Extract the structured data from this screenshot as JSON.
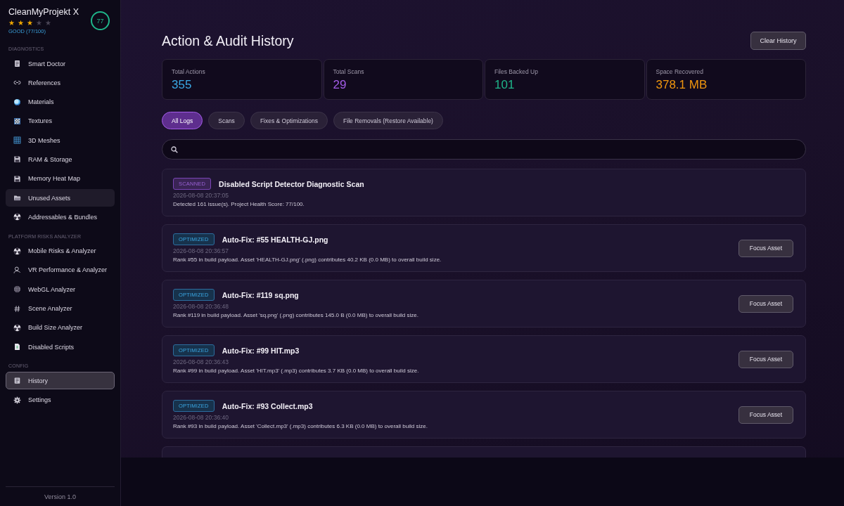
{
  "app": {
    "name": "CleanMyProjekt X",
    "stars": 3,
    "rating": "GOOD (77/100)",
    "score": "77"
  },
  "sidebar": {
    "sections": [
      {
        "label": "DIAGNOSTICS",
        "items": [
          {
            "label": "Smart Doctor",
            "selected": false,
            "hovered": false
          },
          {
            "label": "References",
            "selected": false,
            "hovered": false
          },
          {
            "label": "Materials",
            "selected": false,
            "hovered": false
          },
          {
            "label": "Textures",
            "selected": false,
            "hovered": false
          },
          {
            "label": "3D Meshes",
            "selected": false,
            "hovered": false
          },
          {
            "label": "RAM & Storage",
            "selected": false,
            "hovered": false
          },
          {
            "label": "Memory Heat Map",
            "selected": false,
            "hovered": false
          },
          {
            "label": "Unused Assets",
            "selected": false,
            "hovered": true
          },
          {
            "label": "Addressables & Bundles",
            "selected": false,
            "hovered": false
          }
        ]
      },
      {
        "label": "PLATFORM RISKS ANALYZER",
        "items": [
          {
            "label": "Mobile Risks & Analyzer",
            "selected": false,
            "hovered": false
          },
          {
            "label": "VR Performance & Analyzer",
            "selected": false,
            "hovered": false
          },
          {
            "label": "WebGL Analyzer",
            "selected": false,
            "hovered": false
          },
          {
            "label": "Scene Analyzer",
            "selected": false,
            "hovered": false
          },
          {
            "label": "Build Size Analyzer",
            "selected": false,
            "hovered": false
          },
          {
            "label": "Disabled Scripts",
            "selected": false,
            "hovered": false
          }
        ]
      },
      {
        "label": "CONFIG",
        "items": [
          {
            "label": "History",
            "selected": true,
            "hovered": false
          },
          {
            "label": "Settings",
            "selected": false,
            "hovered": false
          }
        ]
      }
    ],
    "version": "Version 1.0"
  },
  "page": {
    "title": "Action & Audit History",
    "clear_button": "Clear History"
  },
  "stats": [
    {
      "label": "Total Actions",
      "value": "355",
      "color": "#3aa9e6"
    },
    {
      "label": "Total Scans",
      "value": "29",
      "color": "#a35ce8"
    },
    {
      "label": "Files Backed Up",
      "value": "101",
      "color": "#1fb58a"
    },
    {
      "label": "Space Recovered",
      "value": "378.1 MB",
      "color": "#f0960e"
    }
  ],
  "filters": [
    {
      "label": "All Logs",
      "selected": true
    },
    {
      "label": "Scans",
      "selected": false
    },
    {
      "label": "Fixes & Optimizations",
      "selected": false
    },
    {
      "label": "File Removals (Restore Available)",
      "selected": false
    }
  ],
  "logs": [
    {
      "kind": "scanned",
      "badge": "SCANNED",
      "title": "Disabled Script Detector Diagnostic Scan",
      "time": "2026-08-08 20:37:05",
      "detail": "Detected 161 issue(s). Project Health Score: 77/100."
    },
    {
      "kind": "optimized",
      "badge": "OPTIMIZED",
      "title": "Auto-Fix: #55 HEALTH-GJ.png",
      "time": "2026-08-08 20:36:57",
      "detail": "Rank #55 in build payload. Asset 'HEALTH-GJ.png' (.png) contributes 40.2 KB (0.0 MB) to overall build size.",
      "button": "Focus Asset"
    },
    {
      "kind": "optimized",
      "badge": "OPTIMIZED",
      "title": "Auto-Fix: #119 sq.png",
      "time": "2026-08-08 20:36:48",
      "detail": "Rank #119 in build payload. Asset 'sq.png' (.png) contributes 145.0 B (0.0 MB) to overall build size.",
      "button": "Focus Asset"
    },
    {
      "kind": "optimized",
      "badge": "OPTIMIZED",
      "title": "Auto-Fix: #99 HIT.mp3",
      "time": "2026-08-08 20:36:43",
      "detail": "Rank #99 in build payload. Asset 'HIT.mp3' (.mp3) contributes 3.7 KB (0.0 MB) to overall build size.",
      "button": "Focus Asset"
    },
    {
      "kind": "optimized",
      "badge": "OPTIMIZED",
      "title": "Auto-Fix: #93 Collect.mp3",
      "time": "2026-08-08 20:36:40",
      "detail": "Rank #93 in build payload. Asset 'Collect.mp3' (.mp3) contributes 6.3 KB (0.0 MB) to overall build size.",
      "button": "Focus Asset"
    }
  ]
}
